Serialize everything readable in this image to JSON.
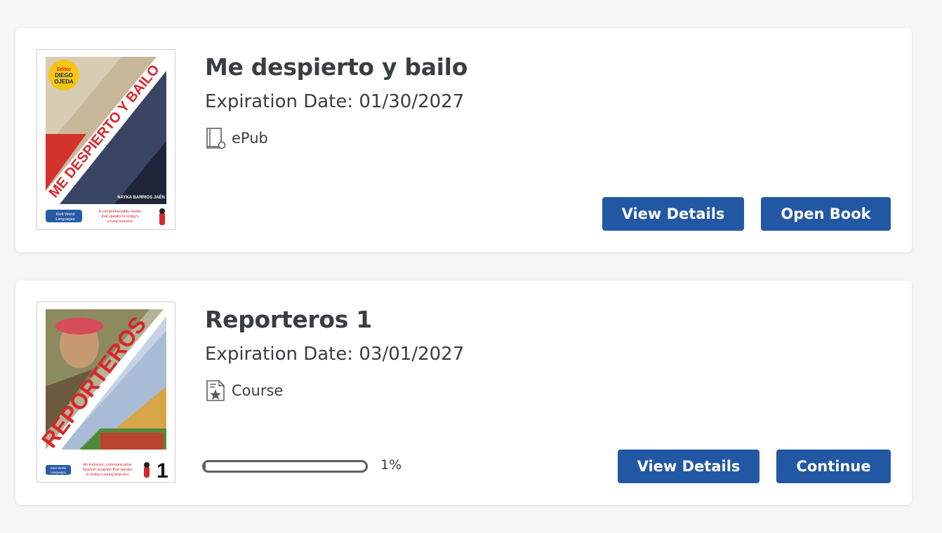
{
  "books": [
    {
      "title": "Me despierto y bailo",
      "expiration": "Expiration Date: 01/30/2027",
      "format": "ePub",
      "format_icon": "book-icon",
      "cover": {
        "title_text": "ME DESPIERTO Y BAILO",
        "editor_badge": [
          "Editor",
          "DIEGO",
          "OJEDA"
        ],
        "author": "NAYKA BARRIOS JAÉN",
        "publisher": [
          "Klett World",
          "Languages"
        ],
        "tagline": [
          "A comprehensible reader",
          "that speaks to today's",
          "young learners"
        ],
        "accent_color": "#d8262b"
      },
      "buttons": {
        "details": "View Details",
        "primary": "Open Book"
      }
    },
    {
      "title": "Reporteros 1",
      "expiration": "Expiration Date: 03/01/2027",
      "format": "Course",
      "format_icon": "course-document-star-icon",
      "cover": {
        "title_text": "REPORTEROS",
        "level": "1",
        "publisher": [
          "Klett World",
          "Languages"
        ],
        "tagline": [
          "An inclusive, communicative",
          "Spanish program that speaks",
          "to today's young learners"
        ],
        "accent_color": "#d8262b"
      },
      "progress": {
        "value": 0.01,
        "label": "1%"
      },
      "buttons": {
        "details": "View Details",
        "primary": "Continue"
      }
    }
  ],
  "colors": {
    "button": "#2257a4",
    "text": "#3a3d44",
    "background": "#f6f6f6"
  }
}
